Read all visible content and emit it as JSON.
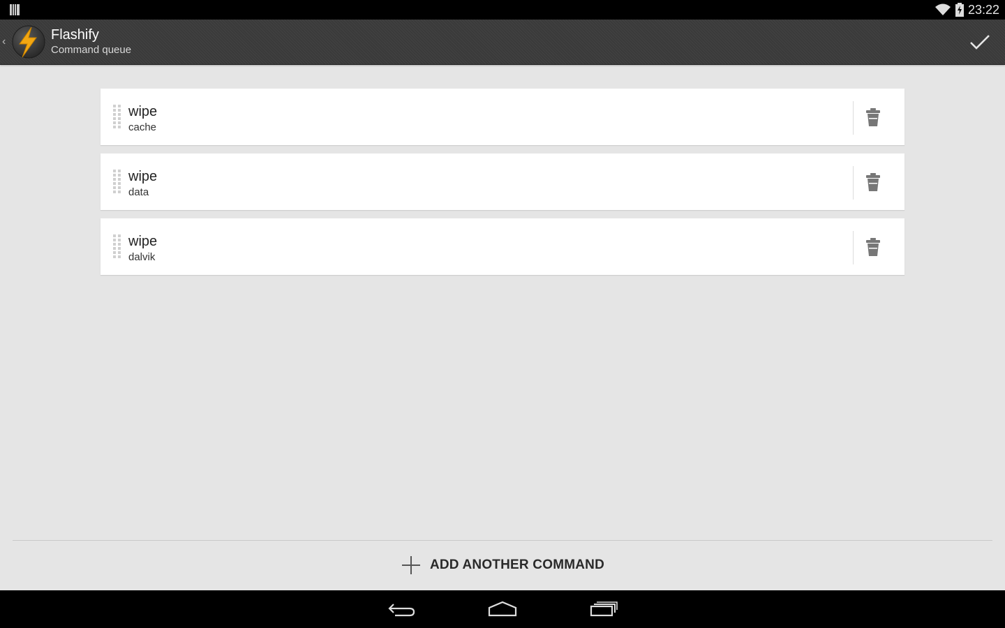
{
  "status_bar": {
    "time": "23:22",
    "icons": [
      "notification-icon",
      "wifi-icon",
      "battery-charging-icon"
    ]
  },
  "action_bar": {
    "title": "Flashify",
    "subtitle": "Command queue",
    "icons": [
      "up-caret-icon",
      "flashify-logo-icon",
      "done-check-icon"
    ],
    "colors": {
      "background": "#3a3a3a",
      "logo_bolt": "#f3a712"
    }
  },
  "commands": [
    {
      "command": "wipe",
      "argument": "cache"
    },
    {
      "command": "wipe",
      "argument": "data"
    },
    {
      "command": "wipe",
      "argument": "dalvik"
    }
  ],
  "add_button": {
    "label": "ADD ANOTHER COMMAND",
    "icon": "plus-icon"
  },
  "nav_bar": {
    "icons": [
      "back-icon",
      "home-icon",
      "recents-icon"
    ]
  }
}
